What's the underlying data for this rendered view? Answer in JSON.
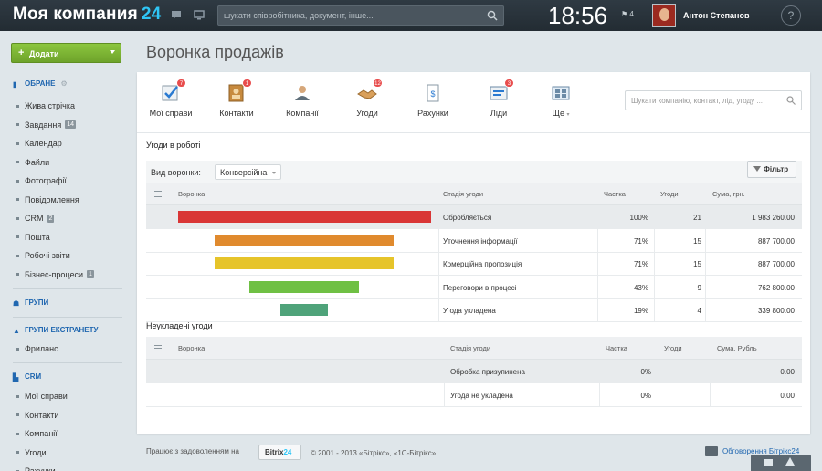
{
  "header": {
    "logo_text": "Моя компания",
    "logo_num": "24",
    "search_placeholder": "шукати співробітника, документ, інше...",
    "clock": "18:56",
    "flag_count": "4",
    "username": "Антон Степанов",
    "help": "?"
  },
  "sidebar": {
    "add_button": "Додати",
    "favorites_title": "ОБРАНЕ",
    "favorites": [
      {
        "label": "Жива стрічка",
        "badge": ""
      },
      {
        "label": "Завдання",
        "badge": "14"
      },
      {
        "label": "Календар",
        "badge": ""
      },
      {
        "label": "Файли",
        "badge": ""
      },
      {
        "label": "Фотографії",
        "badge": ""
      },
      {
        "label": "Повідомлення",
        "badge": ""
      },
      {
        "label": "CRM",
        "badge": "2"
      },
      {
        "label": "Пошта",
        "badge": ""
      },
      {
        "label": "Робочі звіти",
        "badge": ""
      },
      {
        "label": "Бізнес-процеси",
        "badge": "1"
      }
    ],
    "groups_title": "ГРУПИ",
    "extranet_title": "ГРУПИ ЕКСТРАНЕТУ",
    "extranet_items": [
      {
        "label": "Фриланс"
      }
    ],
    "crm_title": "CRM",
    "crm_items": [
      {
        "label": "Мої справи"
      },
      {
        "label": "Контакти"
      },
      {
        "label": "Компанії"
      },
      {
        "label": "Угоди"
      },
      {
        "label": "Рахунки"
      }
    ]
  },
  "main": {
    "page_title": "Воронка продажів",
    "nav": [
      {
        "label": "Мої справи",
        "counter": "7"
      },
      {
        "label": "Контакти",
        "counter": "1"
      },
      {
        "label": "Компанії",
        "counter": ""
      },
      {
        "label": "Угоди",
        "counter": "12"
      },
      {
        "label": "Рахунки",
        "counter": ""
      },
      {
        "label": "Ліди",
        "counter": "3"
      },
      {
        "label": "Ще",
        "counter": ""
      }
    ],
    "crm_search_placeholder": "Шукати компанію, контакт, лід, угоду ...",
    "in_work_title": "Угоди в роботі",
    "funnel_type_label": "Вид воронки:",
    "funnel_type_value": "Конверсійна",
    "filter_label": "Фільтр",
    "table1": {
      "headers": [
        "Воронка",
        "Стадія угоди",
        "Частка",
        "Угоди",
        "Сума, грн."
      ],
      "rows": [
        {
          "stage": "Обробляється",
          "share": "100%",
          "deals": "21",
          "sum": "1 983 260.00",
          "color": "#d93636",
          "share_value": 100
        },
        {
          "stage": "Уточнення інформації",
          "share": "71%",
          "deals": "15",
          "sum": "887 700.00",
          "color": "#e08a2e",
          "share_value": 71
        },
        {
          "stage": "Комерційна пропозиція",
          "share": "71%",
          "deals": "15",
          "sum": "887 700.00",
          "color": "#e6c42a",
          "share_value": 71
        },
        {
          "stage": "Переговори в процесі",
          "share": "43%",
          "deals": "9",
          "sum": "762 800.00",
          "color": "#6fc044",
          "share_value": 43
        },
        {
          "stage": "Угода укладена",
          "share": "19%",
          "deals": "4",
          "sum": "339 800.00",
          "color": "#4fa37a",
          "share_value": 19
        }
      ]
    },
    "failed_title": "Неукладені угоди",
    "table2": {
      "headers": [
        "Воронка",
        "Стадія угоди",
        "Частка",
        "Угоди",
        "Сума, Рубль"
      ],
      "rows": [
        {
          "stage": "Обробка призупинена",
          "share": "0%",
          "deals": "",
          "sum": "0.00"
        },
        {
          "stage": "Угода не укладена",
          "share": "0%",
          "deals": "",
          "sum": "0.00"
        }
      ]
    }
  },
  "footer": {
    "text": "Працює з задоволенням на",
    "bitrix": "Bitrix",
    "bitrix_num": "24",
    "copyright": "© 2001 - 2013 «Бітрікс», «1С-Бітрікс»",
    "discuss": "Обговорення Бітрікс24"
  }
}
